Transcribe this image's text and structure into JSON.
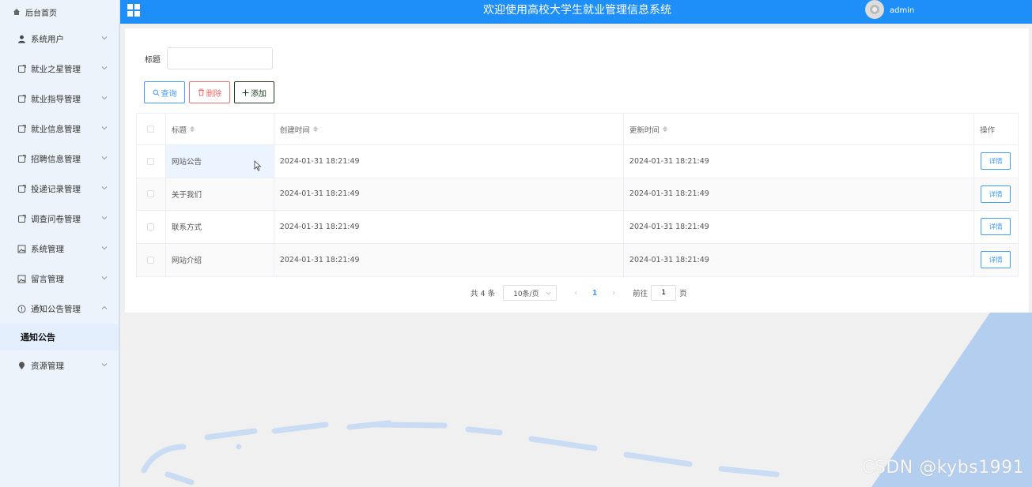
{
  "header": {
    "brand_label": "后台首页",
    "title": "欢迎使用高校大学生就业管理信息系统",
    "username": "admin"
  },
  "sidebar": {
    "items": [
      {
        "label": "系统用户",
        "icon": "user-icon"
      },
      {
        "label": "就业之星管理",
        "icon": "doc-icon"
      },
      {
        "label": "就业指导管理",
        "icon": "doc-icon"
      },
      {
        "label": "就业信息管理",
        "icon": "doc-icon"
      },
      {
        "label": "招聘信息管理",
        "icon": "doc-icon"
      },
      {
        "label": "投递记录管理",
        "icon": "doc-icon"
      },
      {
        "label": "调查问卷管理",
        "icon": "doc-icon"
      },
      {
        "label": "系统管理",
        "icon": "picture-icon"
      },
      {
        "label": "留言管理",
        "icon": "picture-icon"
      },
      {
        "label": "通知公告管理",
        "icon": "info-icon"
      },
      {
        "label": "资源管理",
        "icon": "location-icon"
      }
    ],
    "active_submenu": "通知公告"
  },
  "search": {
    "title_label": "标题",
    "title_value": "",
    "query_label": "查询",
    "delete_label": "删除",
    "add_label": "添加"
  },
  "table": {
    "columns": [
      "标题",
      "创建时间",
      "更新时间",
      "操作"
    ],
    "rows": [
      {
        "title": "网站公告",
        "created": "2024-01-31 18:21:49",
        "updated": "2024-01-31 18:21:49",
        "action": "详情"
      },
      {
        "title": "关于我们",
        "created": "2024-01-31 18:21:49",
        "updated": "2024-01-31 18:21:49",
        "action": "详情"
      },
      {
        "title": "联系方式",
        "created": "2024-01-31 18:21:49",
        "updated": "2024-01-31 18:21:49",
        "action": "详情"
      },
      {
        "title": "网站介绍",
        "created": "2024-01-31 18:21:49",
        "updated": "2024-01-31 18:21:49",
        "action": "详情"
      }
    ]
  },
  "pagination": {
    "total_text": "共 4 条",
    "page_size": "10条/页",
    "current_page": "1",
    "goto_label": "前往",
    "goto_value": "1",
    "goto_suffix": "页"
  },
  "watermark": "CSDN @kybs1991",
  "colors": {
    "header_bg": "#1e8ff8",
    "sidebar_bg": "#edf3fb",
    "primary": "#409eff",
    "danger": "#f56c6c"
  }
}
